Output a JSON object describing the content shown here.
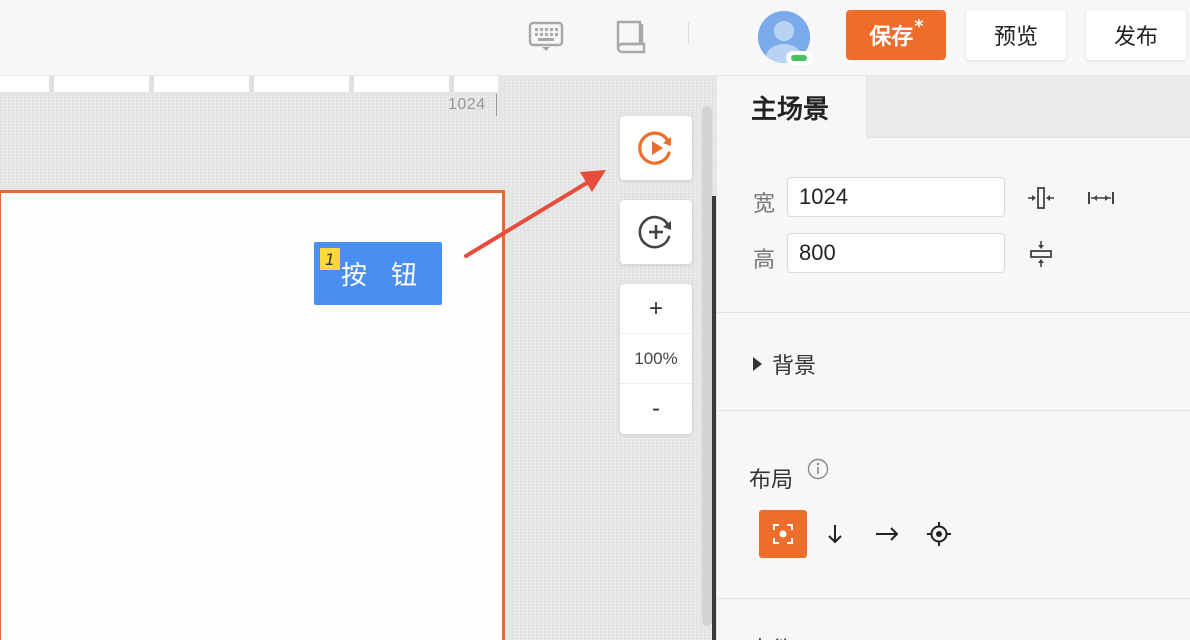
{
  "topbar": {
    "keyboard_icon": "keyboard-icon",
    "book_icon": "book-icon",
    "avatar_icon": "user-avatar-icon",
    "save_label": "保存",
    "save_modified": "*",
    "preview_label": "预览",
    "publish_label": "发布",
    "accent_color": "#ee6d2b"
  },
  "canvas": {
    "ruler_label": "1024",
    "element": {
      "index": "1",
      "label": "按 钮"
    },
    "zoom": {
      "in": "+",
      "level": "100%",
      "out": "-"
    },
    "tool_icons": [
      "play-circle-icon",
      "add-circle-icon"
    ],
    "stage_border_color": "#e96a2c",
    "element_color": "#4a8ef2",
    "annotation_arrow_color": "#e74c3c"
  },
  "panel": {
    "tab_title": "主场景",
    "width_label": "宽",
    "width_value": "1024",
    "height_label": "高",
    "height_value": "800",
    "background_label": "背景",
    "layout_label": "布局",
    "next_section_label": "事件"
  }
}
